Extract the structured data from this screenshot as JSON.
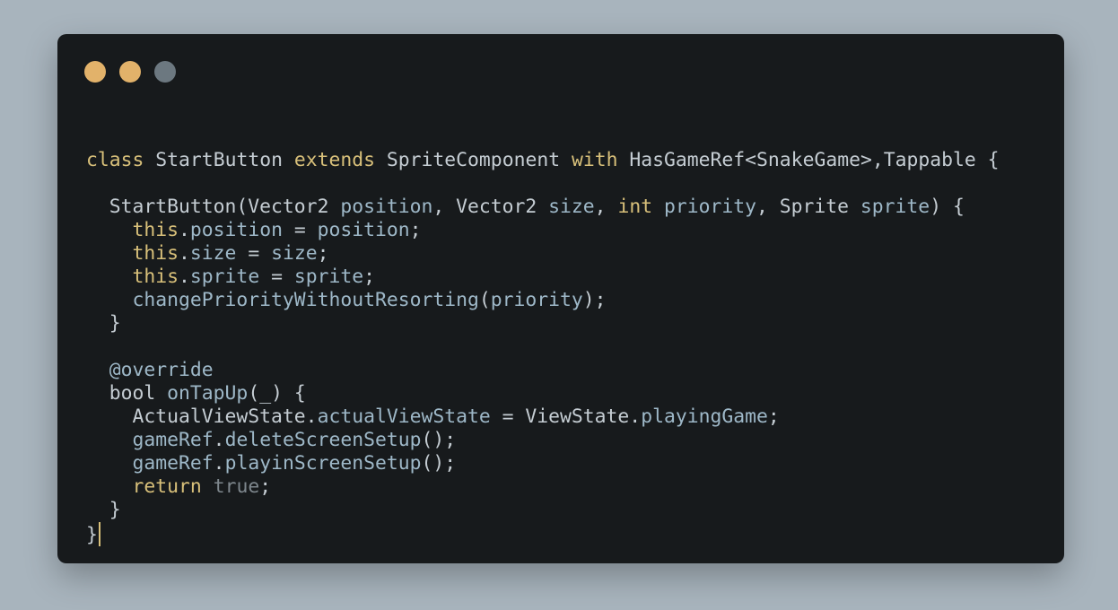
{
  "colors": {
    "background": "#a8b4bd",
    "window": "#171a1c",
    "keyword": "#d8c07a",
    "identifier": "#9eb8c8",
    "plain": "#c5cdd3",
    "muted": "#7e878d",
    "cursor": "#d8c07a"
  },
  "window": {
    "controls": [
      {
        "name": "close",
        "color": "#e2b26a"
      },
      {
        "name": "minimize",
        "color": "#e2b26a"
      },
      {
        "name": "zoom",
        "color": "#6c7880"
      }
    ]
  },
  "code": {
    "lines": [
      [],
      [
        {
          "t": "class",
          "c": "keyword"
        },
        {
          "t": " ",
          "c": "plain"
        },
        {
          "t": "StartButton",
          "c": "plain"
        },
        {
          "t": " ",
          "c": "plain"
        },
        {
          "t": "extends",
          "c": "keyword"
        },
        {
          "t": " ",
          "c": "plain"
        },
        {
          "t": "SpriteComponent",
          "c": "plain"
        },
        {
          "t": " ",
          "c": "plain"
        },
        {
          "t": "with",
          "c": "keyword"
        },
        {
          "t": " ",
          "c": "plain"
        },
        {
          "t": "HasGameRef<SnakeGame>,Tappable {",
          "c": "plain"
        }
      ],
      [],
      [
        {
          "t": "  StartButton(Vector2 ",
          "c": "plain"
        },
        {
          "t": "position",
          "c": "identifier"
        },
        {
          "t": ", Vector2 ",
          "c": "plain"
        },
        {
          "t": "size",
          "c": "identifier"
        },
        {
          "t": ", ",
          "c": "plain"
        },
        {
          "t": "int",
          "c": "keyword"
        },
        {
          "t": " ",
          "c": "plain"
        },
        {
          "t": "priority",
          "c": "identifier"
        },
        {
          "t": ", Sprite ",
          "c": "plain"
        },
        {
          "t": "sprite",
          "c": "identifier"
        },
        {
          "t": ") {",
          "c": "plain"
        }
      ],
      [
        {
          "t": "    ",
          "c": "plain"
        },
        {
          "t": "this",
          "c": "keyword"
        },
        {
          "t": ".",
          "c": "plain"
        },
        {
          "t": "position",
          "c": "identifier"
        },
        {
          "t": " = ",
          "c": "plain"
        },
        {
          "t": "position",
          "c": "identifier"
        },
        {
          "t": ";",
          "c": "plain"
        }
      ],
      [
        {
          "t": "    ",
          "c": "plain"
        },
        {
          "t": "this",
          "c": "keyword"
        },
        {
          "t": ".",
          "c": "plain"
        },
        {
          "t": "size",
          "c": "identifier"
        },
        {
          "t": " = ",
          "c": "plain"
        },
        {
          "t": "size",
          "c": "identifier"
        },
        {
          "t": ";",
          "c": "plain"
        }
      ],
      [
        {
          "t": "    ",
          "c": "plain"
        },
        {
          "t": "this",
          "c": "keyword"
        },
        {
          "t": ".",
          "c": "plain"
        },
        {
          "t": "sprite",
          "c": "identifier"
        },
        {
          "t": " = ",
          "c": "plain"
        },
        {
          "t": "sprite",
          "c": "identifier"
        },
        {
          "t": ";",
          "c": "plain"
        }
      ],
      [
        {
          "t": "    ",
          "c": "plain"
        },
        {
          "t": "changePriorityWithoutResorting",
          "c": "identifier"
        },
        {
          "t": "(",
          "c": "plain"
        },
        {
          "t": "priority",
          "c": "identifier"
        },
        {
          "t": ");",
          "c": "plain"
        }
      ],
      [
        {
          "t": "  }",
          "c": "plain"
        }
      ],
      [],
      [
        {
          "t": "  ",
          "c": "plain"
        },
        {
          "t": "@override",
          "c": "identifier"
        }
      ],
      [
        {
          "t": "  bool ",
          "c": "plain"
        },
        {
          "t": "onTapUp",
          "c": "identifier"
        },
        {
          "t": "(_) {",
          "c": "plain"
        }
      ],
      [
        {
          "t": "    ActualViewState.",
          "c": "plain"
        },
        {
          "t": "actualViewState",
          "c": "identifier"
        },
        {
          "t": " = ViewState.",
          "c": "plain"
        },
        {
          "t": "playingGame",
          "c": "identifier"
        },
        {
          "t": ";",
          "c": "plain"
        }
      ],
      [
        {
          "t": "    ",
          "c": "plain"
        },
        {
          "t": "gameRef",
          "c": "identifier"
        },
        {
          "t": ".",
          "c": "plain"
        },
        {
          "t": "deleteScreenSetup",
          "c": "identifier"
        },
        {
          "t": "();",
          "c": "plain"
        }
      ],
      [
        {
          "t": "    ",
          "c": "plain"
        },
        {
          "t": "gameRef",
          "c": "identifier"
        },
        {
          "t": ".",
          "c": "plain"
        },
        {
          "t": "playinScreenSetup",
          "c": "identifier"
        },
        {
          "t": "();",
          "c": "plain"
        }
      ],
      [
        {
          "t": "    ",
          "c": "plain"
        },
        {
          "t": "return",
          "c": "keyword"
        },
        {
          "t": " ",
          "c": "plain"
        },
        {
          "t": "true",
          "c": "muted"
        },
        {
          "t": ";",
          "c": "plain"
        }
      ],
      [
        {
          "t": "  }",
          "c": "plain"
        }
      ],
      [
        {
          "t": "}",
          "c": "plain"
        }
      ]
    ]
  }
}
